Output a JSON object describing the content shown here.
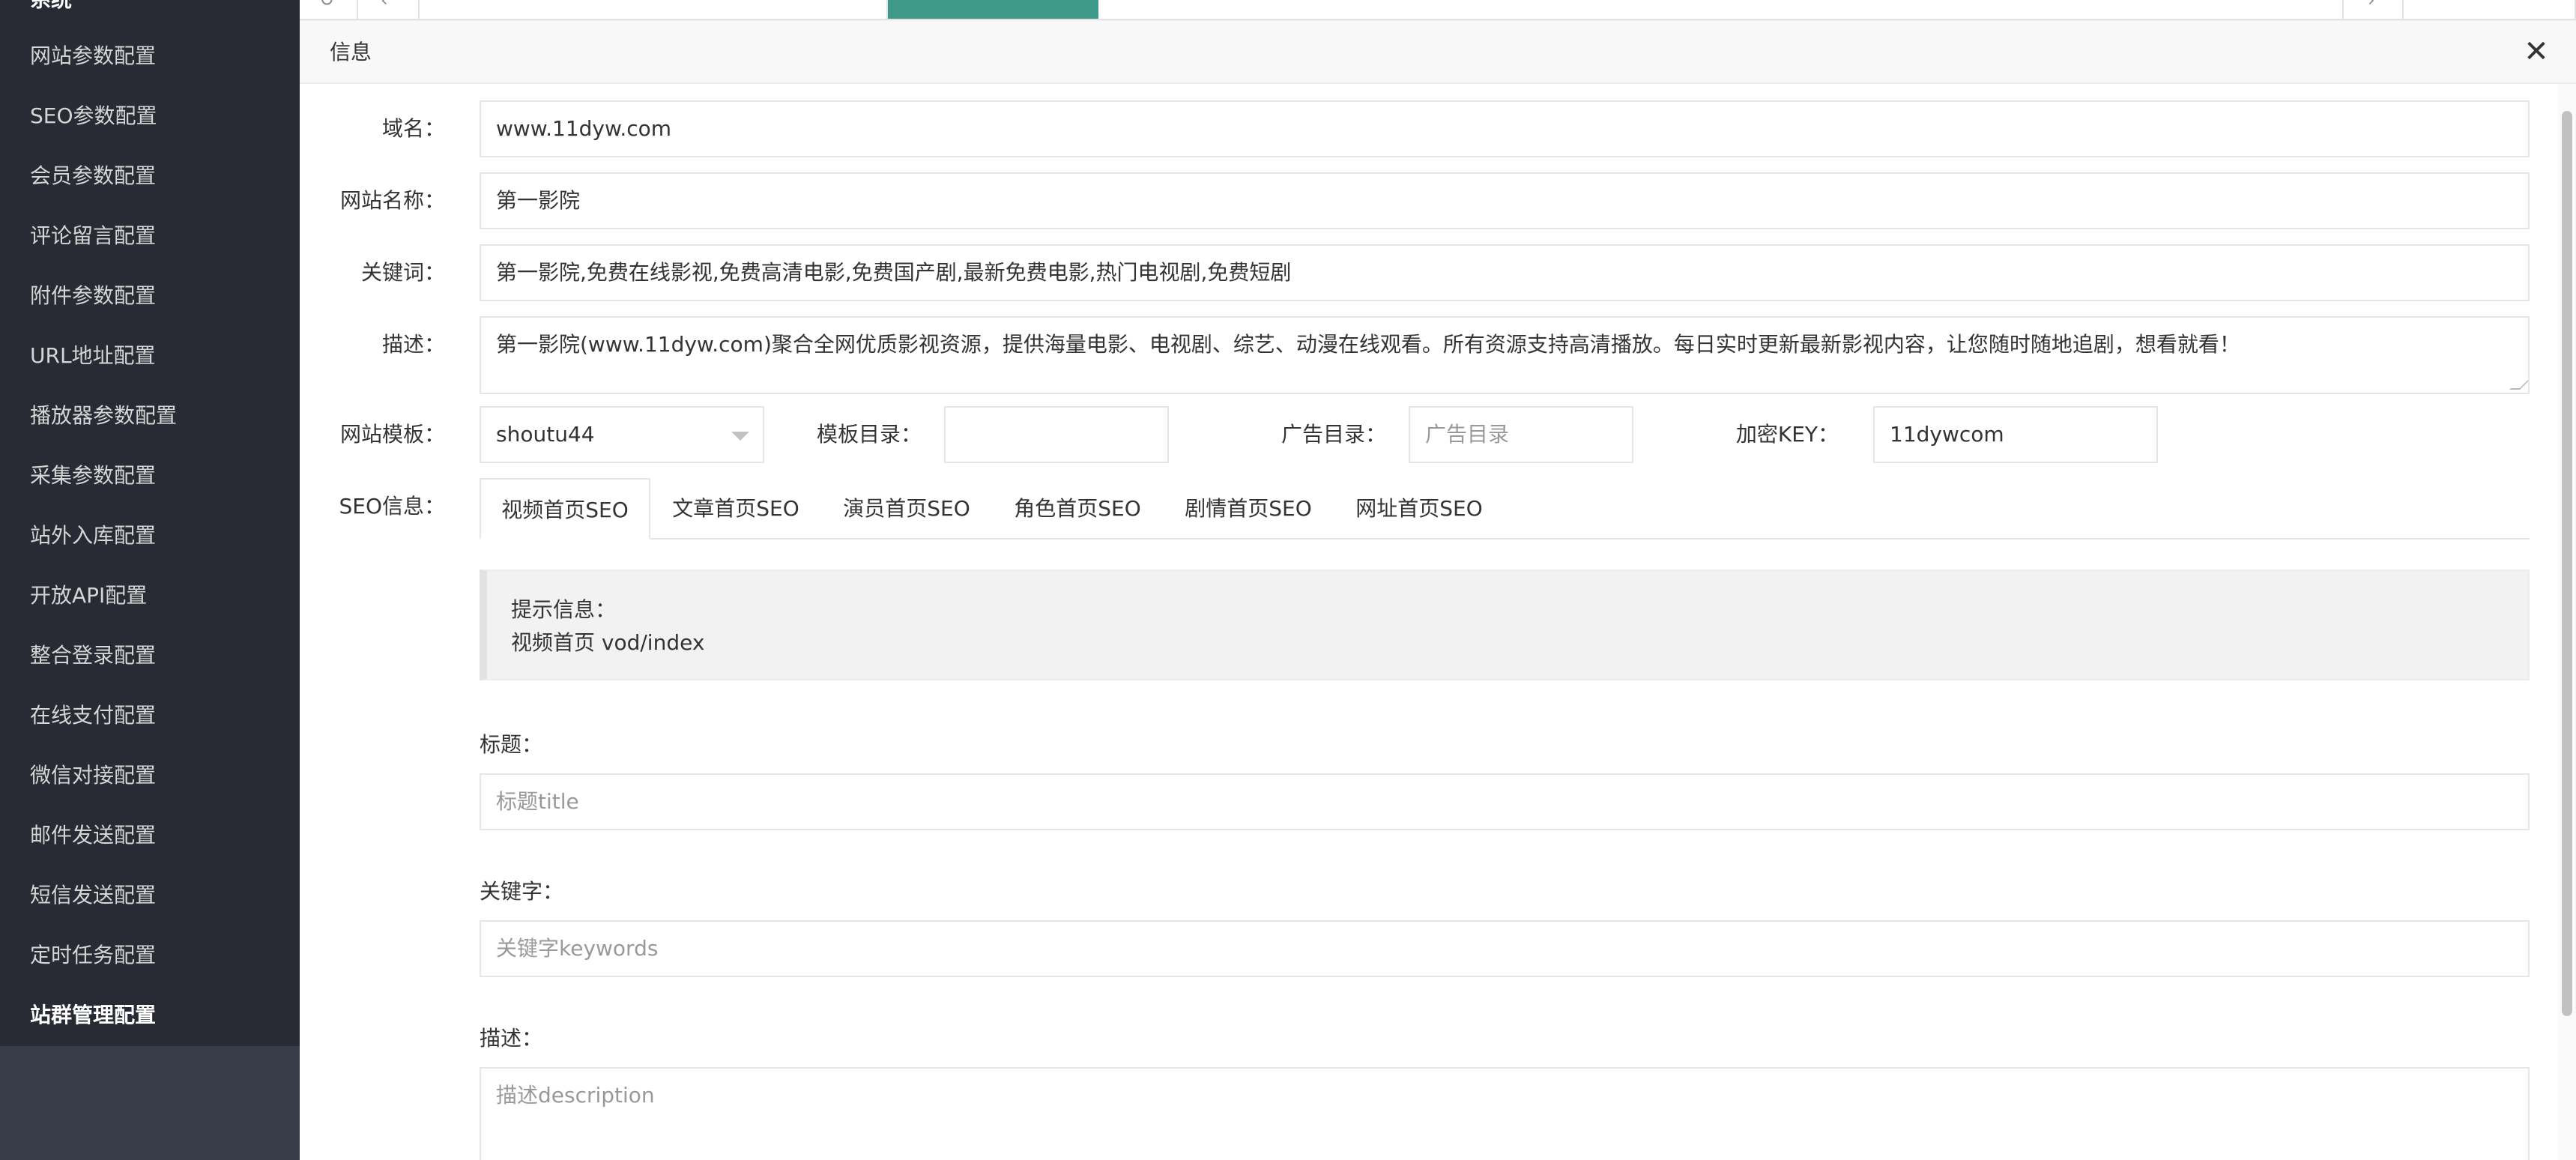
{
  "sidebar": {
    "header": "系统",
    "items": [
      {
        "label": "网站参数配置"
      },
      {
        "label": "SEO参数配置"
      },
      {
        "label": "会员参数配置"
      },
      {
        "label": "评论留言配置"
      },
      {
        "label": "附件参数配置"
      },
      {
        "label": "URL地址配置"
      },
      {
        "label": "播放器参数配置"
      },
      {
        "label": "采集参数配置"
      },
      {
        "label": "站外入库配置"
      },
      {
        "label": "开放API配置"
      },
      {
        "label": "整合登录配置"
      },
      {
        "label": "在线支付配置"
      },
      {
        "label": "微信对接配置"
      },
      {
        "label": "邮件发送配置"
      },
      {
        "label": "短信发送配置"
      },
      {
        "label": "定时任务配置"
      },
      {
        "label": "站群管理配置"
      }
    ],
    "active_index": 16
  },
  "dialog": {
    "title": "信息",
    "close_icon": "close-icon"
  },
  "form": {
    "domain": {
      "label": "域名：",
      "value": "www.11dyw.com"
    },
    "site_name": {
      "label": "网站名称：",
      "value": "第一影院"
    },
    "keywords": {
      "label": "关键词：",
      "value": "第一影院,免费在线影视,免费高清电影,免费国产剧,最新免费电影,热门电视剧,免费短剧"
    },
    "description": {
      "label": "描述：",
      "value": "第一影院(www.11dyw.com)聚合全网优质影视资源，提供海量电影、电视剧、综艺、动漫在线观看。所有资源支持高清播放。每日实时更新最新影视内容，让您随时随地追剧，想看就看！"
    },
    "template": {
      "label": "网站模板：",
      "value": "shoutu44"
    },
    "template_dir": {
      "label": "模板目录：",
      "value": ""
    },
    "ad_dir": {
      "label": "广告目录：",
      "placeholder": "广告目录"
    },
    "encrypt_key": {
      "label": "加密KEY：",
      "value": "11dywcom"
    },
    "seo_info_label": "SEO信息："
  },
  "seo_tabs": [
    {
      "label": "视频首页SEO",
      "active": true
    },
    {
      "label": "文章首页SEO",
      "active": false
    },
    {
      "label": "演员首页SEO",
      "active": false
    },
    {
      "label": "角色首页SEO",
      "active": false
    },
    {
      "label": "剧情首页SEO",
      "active": false
    },
    {
      "label": "网址首页SEO",
      "active": false
    }
  ],
  "tip": {
    "title": "提示信息：",
    "text": "视频首页 vod/index"
  },
  "seo_fields": {
    "title": {
      "label": "标题：",
      "placeholder": "标题title"
    },
    "keywords": {
      "label": "关键字：",
      "placeholder": "关键字keywords"
    },
    "description": {
      "label": "描述：",
      "placeholder": "描述description"
    }
  },
  "colors": {
    "sidebar_bg": "#282b33",
    "accent_tab": "#3f9a8a"
  }
}
